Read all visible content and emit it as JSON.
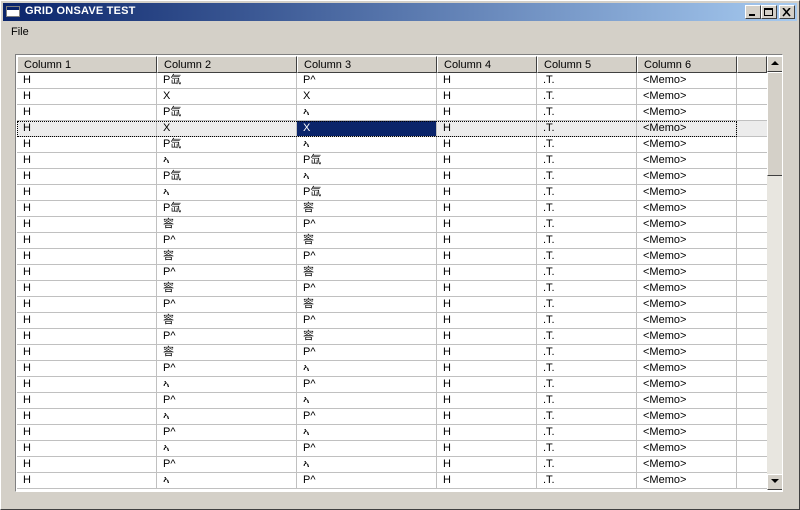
{
  "window": {
    "title": "GRID ONSAVE TEST"
  },
  "menu": [
    "File"
  ],
  "grid": {
    "columns": [
      "Column 1",
      "Column 2",
      "Column 3",
      "Column 4",
      "Column 5",
      "Column 6"
    ],
    "selected_row": 3,
    "active_column": 2,
    "rows": [
      [
        "H",
        "P氙",
        "P^",
        "H",
        ".T.",
        "<Memo>"
      ],
      [
        "H",
        "X",
        "X",
        "H",
        ".T.",
        "<Memo>"
      ],
      [
        "H",
        "P氙",
        "ኣ",
        "H",
        ".T.",
        "<Memo>"
      ],
      [
        "H",
        "X",
        "X",
        "H",
        ".T.",
        "<Memo>"
      ],
      [
        "H",
        "P氙",
        "ኣ",
        "H",
        ".T.",
        "<Memo>"
      ],
      [
        "H",
        "ኣ",
        "P氙",
        "H",
        ".T.",
        "<Memo>"
      ],
      [
        "H",
        "P氙",
        "ኣ",
        "H",
        ".T.",
        "<Memo>"
      ],
      [
        "H",
        "ኣ",
        "P氙",
        "H",
        ".T.",
        "<Memo>"
      ],
      [
        "H",
        "P氙",
        "䆟",
        "H",
        ".T.",
        "<Memo>"
      ],
      [
        "H",
        "䆟",
        "P^",
        "H",
        ".T.",
        "<Memo>"
      ],
      [
        "H",
        "P^",
        "䆟",
        "H",
        ".T.",
        "<Memo>"
      ],
      [
        "H",
        "䆟",
        "P^",
        "H",
        ".T.",
        "<Memo>"
      ],
      [
        "H",
        "P^",
        "䆟",
        "H",
        ".T.",
        "<Memo>"
      ],
      [
        "H",
        "䆟",
        "P^",
        "H",
        ".T.",
        "<Memo>"
      ],
      [
        "H",
        "P^",
        "䆟",
        "H",
        ".T.",
        "<Memo>"
      ],
      [
        "H",
        "䆟",
        "P^",
        "H",
        ".T.",
        "<Memo>"
      ],
      [
        "H",
        "P^",
        "䆟",
        "H",
        ".T.",
        "<Memo>"
      ],
      [
        "H",
        "䆟",
        "P^",
        "H",
        ".T.",
        "<Memo>"
      ],
      [
        "H",
        "P^",
        "ኣ",
        "H",
        ".T.",
        "<Memo>"
      ],
      [
        "H",
        "ኣ",
        "P^",
        "H",
        ".T.",
        "<Memo>"
      ],
      [
        "H",
        "P^",
        "ኣ",
        "H",
        ".T.",
        "<Memo>"
      ],
      [
        "H",
        "ኣ",
        "P^",
        "H",
        ".T.",
        "<Memo>"
      ],
      [
        "H",
        "P^",
        "ኣ",
        "H",
        ".T.",
        "<Memo>"
      ],
      [
        "H",
        "ኣ",
        "P^",
        "H",
        ".T.",
        "<Memo>"
      ],
      [
        "H",
        "P^",
        "ኣ",
        "H",
        ".T.",
        "<Memo>"
      ],
      [
        "H",
        "ኣ",
        "P^",
        "H",
        ".T.",
        "<Memo>"
      ]
    ]
  },
  "colors": {
    "title_start": "#0a246a",
    "title_end": "#a6caf0",
    "face": "#d4d0c8",
    "selection": "#0a246a"
  }
}
